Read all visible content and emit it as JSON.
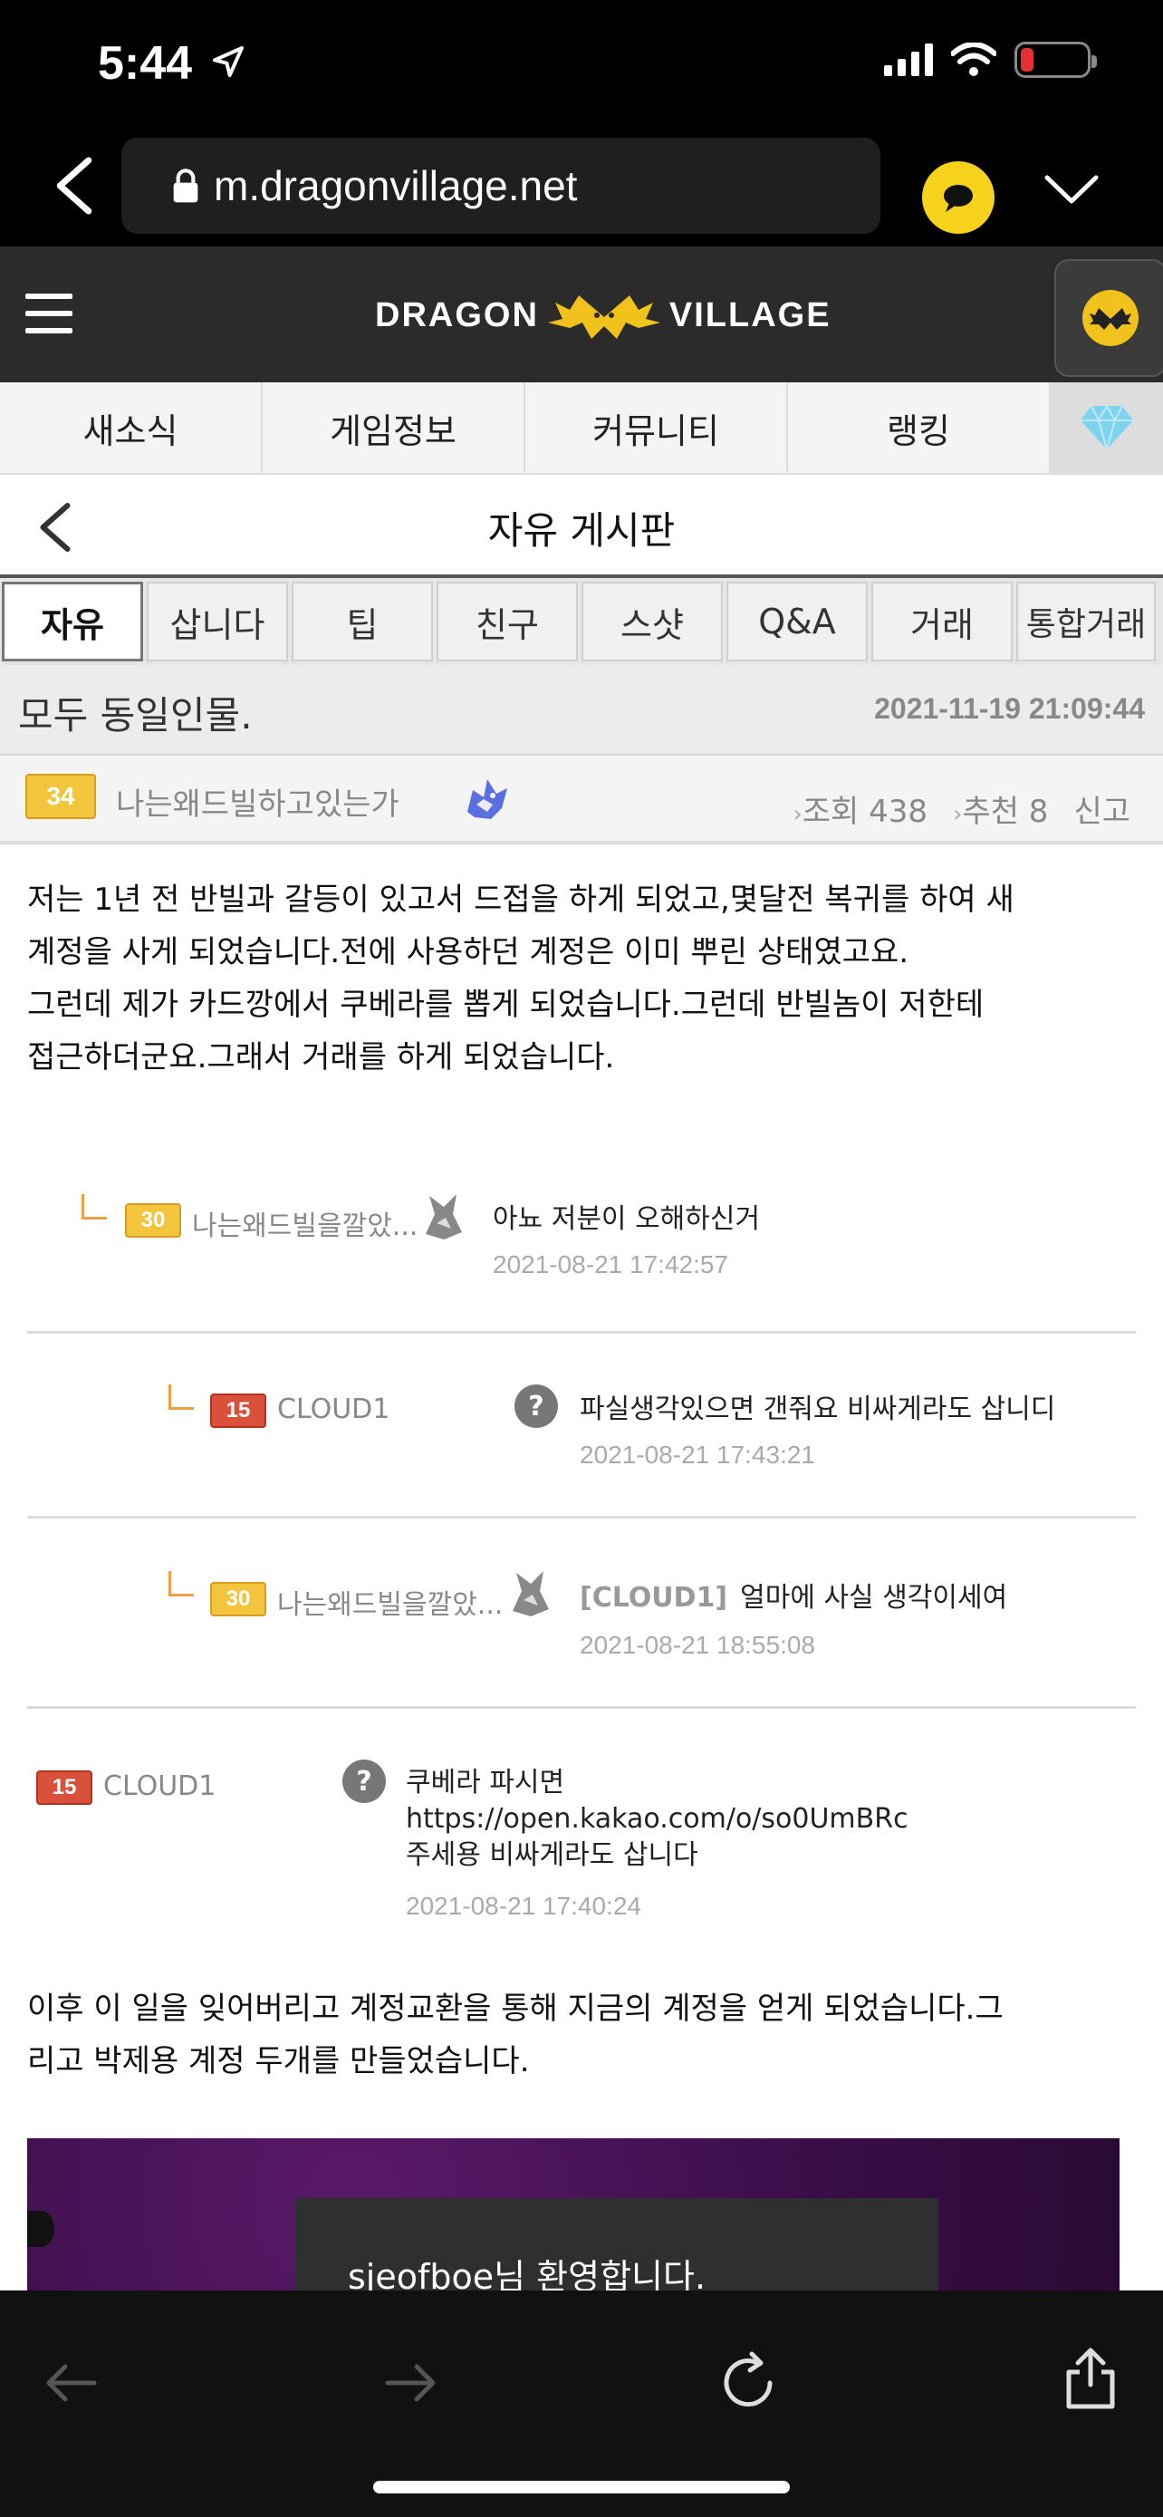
{
  "status_bar": {
    "time": "5:44"
  },
  "browser": {
    "url": "m.dragonvillage.net"
  },
  "site": {
    "logo_left": "DRAGON",
    "logo_right": "VILLAGE"
  },
  "main_nav": {
    "items": [
      "새소식",
      "게임정보",
      "커뮤니티",
      "랭킹"
    ]
  },
  "board": {
    "title": "자유 게시판"
  },
  "category_tabs": {
    "items": [
      "자유",
      "삽니다",
      "팁",
      "친구",
      "스샷",
      "Q&A",
      "거래",
      "통합거래"
    ],
    "active": "자유"
  },
  "post": {
    "title": "모두 동일인물.",
    "date": "2021-11-19 21:09:44",
    "author_level": "34",
    "author": "나는왜드빌하고있는가",
    "views": "조회 438",
    "recommend": "추천 8",
    "report": "신고",
    "paragraph1": [
      "저는 1년 전 반빌과 갈등이 있고서 드접을 하게 되었고,몇달전 복귀를 하여 새",
      "계정을 사게 되었습니다.전에 사용하던 계정은 이미 뿌린 상태였고요.",
      "그런데 제가 카드깡에서 쿠베라를 뽑게 되었습니다.그런데 반빌놈이 저한테",
      "접근하더군요.그래서 거래를 하게 되었습니다."
    ],
    "paragraph2": [
      "이후 이 일을 잊어버리고 계정교환을 통해 지금의 계정을 얻게 되었습니다.그",
      "리고 박제용 계정 두개를 만들었습니다."
    ]
  },
  "comments": [
    {
      "level": "30",
      "author": "나는왜드빌을깔았...",
      "mention": "",
      "text": "아뇨 저분이 오해하신거",
      "date": "2021-08-21 17:42:57"
    },
    {
      "level": "15",
      "author": "CLOUD1",
      "mention": "",
      "text": "파실생각있으면 갠줘요 비싸게라도 삽니디",
      "date": "2021-08-21 17:43:21"
    },
    {
      "level": "30",
      "author": "나는왜드빌을깔았...",
      "mention": "[CLOUD1]",
      "text": "얼마에 사실 생각이세여",
      "date": "2021-08-21 18:55:08"
    },
    {
      "level": "15",
      "author": "CLOUD1",
      "mention": "",
      "text_lines": [
        "쿠베라 파시면",
        "https://open.kakao.com/o/so0UmBRc",
        "주세용 비싸게라도 삽니다"
      ],
      "date": "2021-08-21 17:40:24"
    }
  ],
  "embed": {
    "text": "sjeofboe님 환영합니다."
  },
  "colors": {
    "accent": "#f1c21b",
    "header_bg": "#2b2b2b",
    "level_gold": "#f3c53c",
    "level_red": "#d9503b"
  }
}
